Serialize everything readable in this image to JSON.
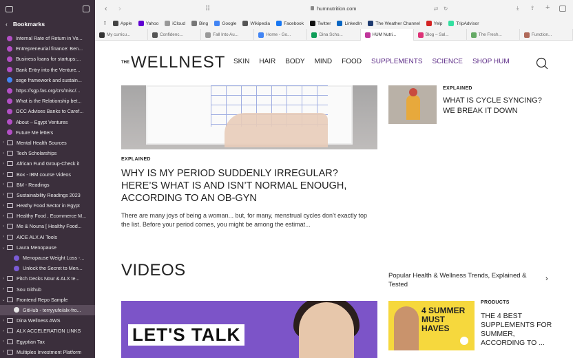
{
  "sidebar": {
    "header": "Bookmarks",
    "items": [
      {
        "label": "Internal Rate of Return in Ve...",
        "type": "fav",
        "color": "#b34fc6"
      },
      {
        "label": "Entrepreneurial finance: Ben...",
        "type": "fav",
        "color": "#b34fc6"
      },
      {
        "label": "Business loans for startups:...",
        "type": "fav",
        "color": "#b34fc6"
      },
      {
        "label": "Bank Entry into the Venture...",
        "type": "fav",
        "color": "#b34fc6"
      },
      {
        "label": "sege framework and sustain...",
        "type": "fav",
        "color": "#4285f4"
      },
      {
        "label": "https://sgp.fas.org/crs/misc/...",
        "type": "fav",
        "color": "#b34fc6"
      },
      {
        "label": "What is the Relationship bet...",
        "type": "fav",
        "color": "#b34fc6"
      },
      {
        "label": "OCC Advises Banks to Caref...",
        "type": "fav",
        "color": "#b34fc6"
      },
      {
        "label": "About – Egypt Ventures",
        "type": "fav",
        "color": "#b34fc6"
      },
      {
        "label": "Future Me letters",
        "type": "fav",
        "color": "#b34fc6"
      },
      {
        "label": "Mental Health Sources",
        "type": "folder"
      },
      {
        "label": "Tech Scholarships",
        "type": "folder"
      },
      {
        "label": "African Fund Group-Check it",
        "type": "folder"
      },
      {
        "label": "Box - IBM course Videos",
        "type": "folder"
      },
      {
        "label": "BM - Readings",
        "type": "folder"
      },
      {
        "label": "Sustainability Readings 2023",
        "type": "folder"
      },
      {
        "label": "Heathy Food Sector in Egypt",
        "type": "folder"
      },
      {
        "label": "Healthy Food , Ecommerce M...",
        "type": "folder"
      },
      {
        "label": "Me & Nouna [ Healthy Food...",
        "type": "folder"
      },
      {
        "label": "AICE ALX AI Tools",
        "type": "folder"
      },
      {
        "label": "Laura Menopause",
        "type": "folder-open"
      },
      {
        "label": "Menopause Weight Loss -...",
        "type": "fav-nested",
        "color": "#7b5cd6"
      },
      {
        "label": "Unlock the Secret to Men...",
        "type": "fav-nested",
        "color": "#7b5cd6"
      },
      {
        "label": "Pitch Decks Nour & ALX te...",
        "type": "folder"
      },
      {
        "label": "Sou Github",
        "type": "folder"
      },
      {
        "label": "Frontend Repo Sample",
        "type": "folder-open"
      },
      {
        "label": "GitHub - terryyufe/alx-fro...",
        "type": "fav-nested-active",
        "color": "#e6e6e6"
      },
      {
        "label": "Dina Wellness AWS",
        "type": "folder"
      },
      {
        "label": "ALX ACCELERATION LINKS",
        "type": "folder"
      },
      {
        "label": "Egyptian Tax",
        "type": "folder"
      },
      {
        "label": "Multiples Investment Platform",
        "type": "folder"
      }
    ]
  },
  "browser": {
    "url": "humnutrition.com",
    "favorites": [
      {
        "label": "Apple",
        "color": "#444"
      },
      {
        "label": "Yahoo",
        "color": "#6001d2"
      },
      {
        "label": "iCloud",
        "color": "#999"
      },
      {
        "label": "Bing",
        "color": "#777"
      },
      {
        "label": "Google",
        "color": "#4285f4"
      },
      {
        "label": "Wikipedia",
        "color": "#555"
      },
      {
        "label": "Facebook",
        "color": "#1877f2"
      },
      {
        "label": "Twitter",
        "color": "#111"
      },
      {
        "label": "LinkedIn",
        "color": "#0a66c2"
      },
      {
        "label": "The Weather Channel",
        "color": "#1f3b70"
      },
      {
        "label": "Yelp",
        "color": "#d32323"
      },
      {
        "label": "TripAdvisor",
        "color": "#34e0a1"
      }
    ],
    "tabs": [
      {
        "label": "My curricu...",
        "color": "#333",
        "active": false
      },
      {
        "label": "Confidenc...",
        "color": "#555",
        "active": false
      },
      {
        "label": "Fall Into Au...",
        "color": "#999",
        "active": false
      },
      {
        "label": "Home - Go...",
        "color": "#4285f4",
        "active": false
      },
      {
        "label": "Dina Scho...",
        "color": "#0f9d58",
        "active": false
      },
      {
        "label": "HUM Nutri...",
        "color": "#c0369b",
        "active": true
      },
      {
        "label": "Blog – Sal...",
        "color": "#d37",
        "active": false
      },
      {
        "label": "The Fresh...",
        "color": "#6a6",
        "active": false
      },
      {
        "label": "Function...",
        "color": "#b06a5a",
        "active": false
      }
    ]
  },
  "site": {
    "logo_the": "THE",
    "logo_main": "WELLNEST",
    "nav": [
      "SKIN",
      "HAIR",
      "BODY",
      "MIND",
      "FOOD",
      "SUPPLEMENTS",
      "SCIENCE",
      "SHOP HUM"
    ]
  },
  "main_article": {
    "kicker": "EXPLAINED",
    "title": "WHY IS MY PERIOD SUDDENLY IRREGULAR? HERE’S WHAT IS AND ISN’T NORMAL ENOUGH, ACCORDING TO AN OB-GYN",
    "description": "There are many joys of being a woman... but, for many, menstrual cycles don’t exactly top the list. Before your period comes, you might be among the estimat..."
  },
  "side_article": {
    "kicker": "EXPLAINED",
    "title": "WHAT IS CYCLE SYNCING? WE BREAK IT DOWN"
  },
  "videos": {
    "heading": "VIDEOS",
    "popular_link": "Popular Health & Wellness Trends, Explained & Tested",
    "video_overlay": "LET'S TALK",
    "side_kicker": "PRODUCTS",
    "side_title": "THE 4 BEST SUPPLEMENTS FOR SUMMER, ACCORDING TO ...",
    "thumb_text_1": "4 SUMMER",
    "thumb_text_2": "MUST",
    "thumb_text_3": "HAVES"
  }
}
